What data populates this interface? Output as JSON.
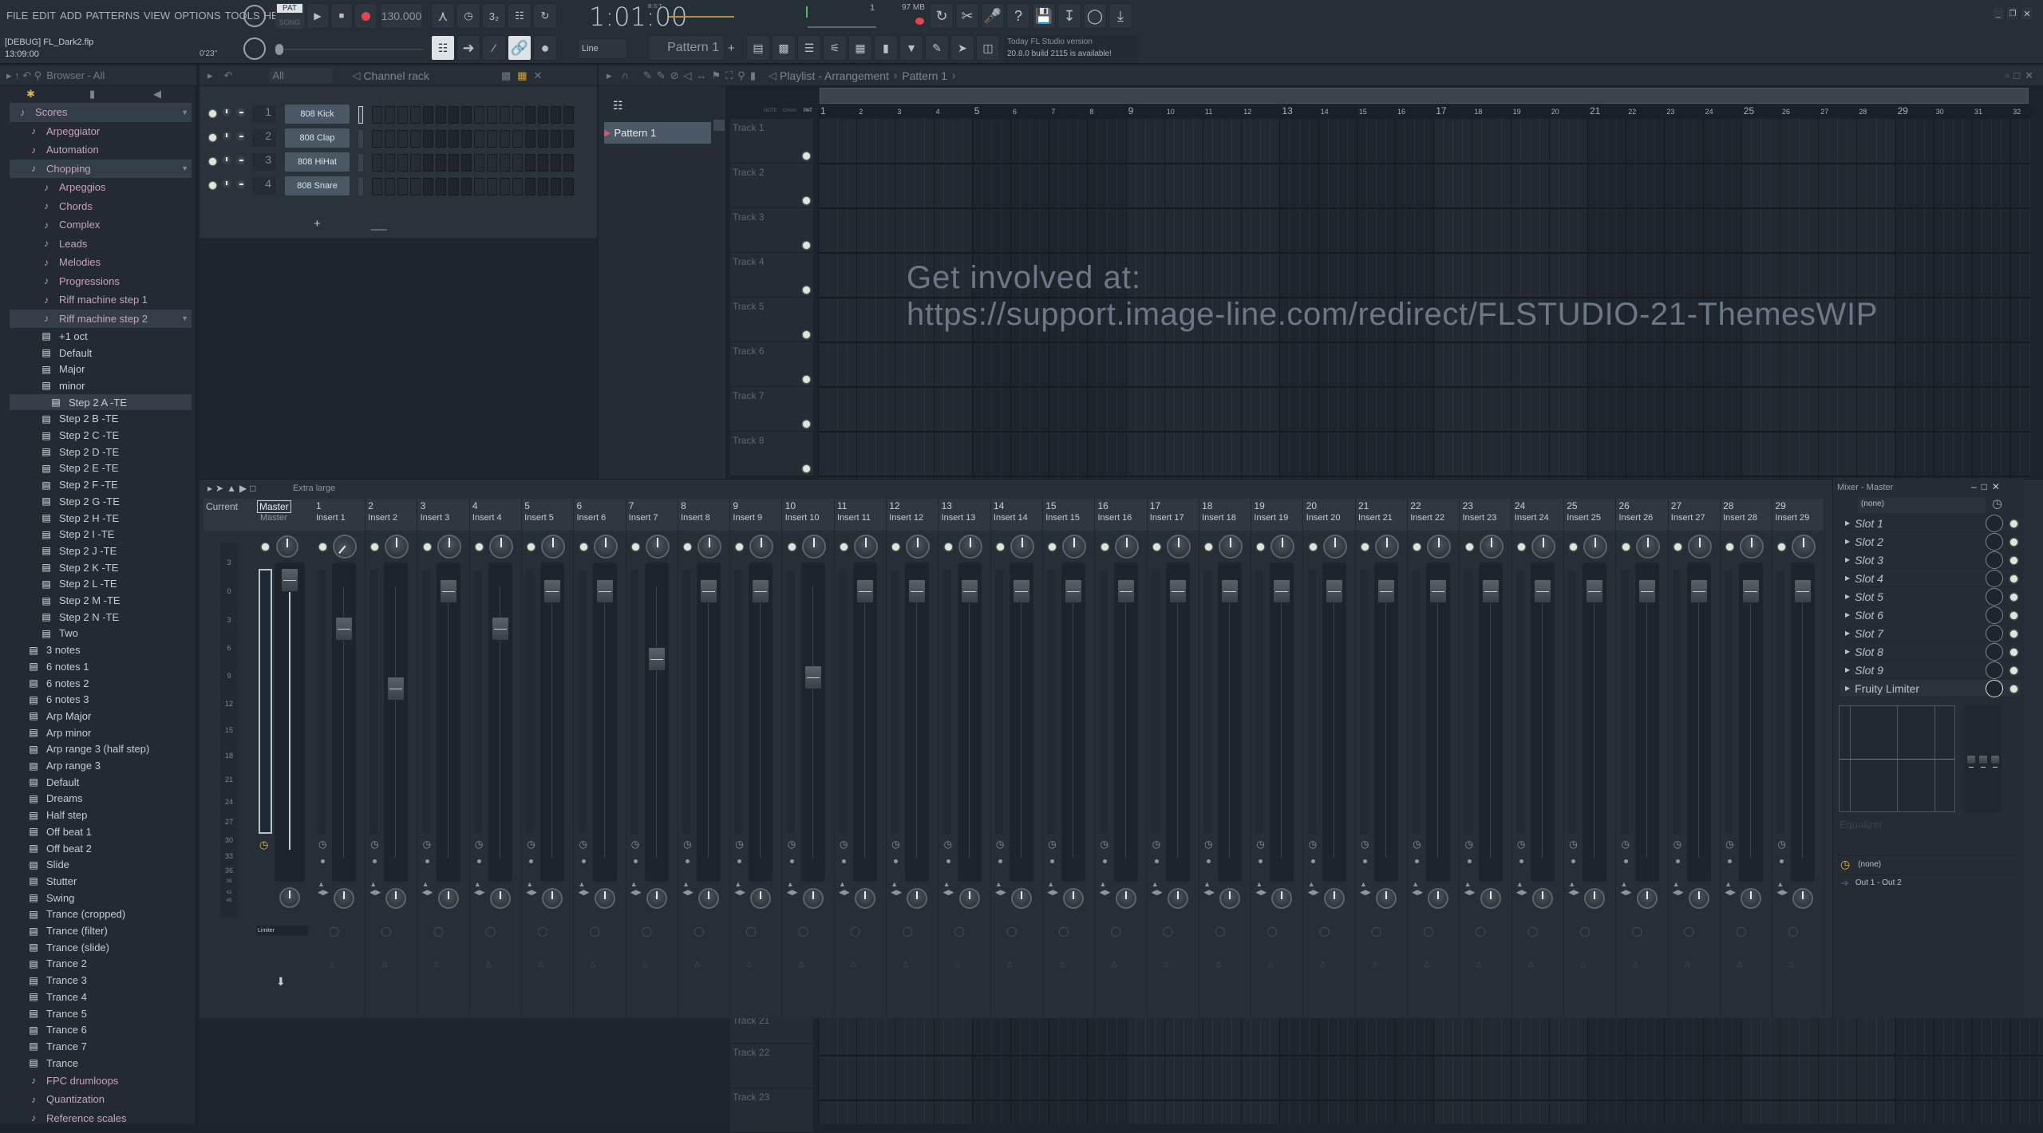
{
  "menu": [
    "FILE",
    "EDIT",
    "ADD",
    "PATTERNS",
    "VIEW",
    "OPTIONS",
    "TOOLS",
    "HELP"
  ],
  "transport": {
    "pat_label": "PAT",
    "song_label": "SONG",
    "tempo": "130.000",
    "time": "1:01:00",
    "time_format": "B:S:T",
    "record_color": "#e8434f",
    "cpu_value": "1",
    "memory": "97 MB"
  },
  "project": {
    "title": "[DEBUG] FL_Dark2.flp",
    "clock": "13:09:00",
    "length": "0'23\""
  },
  "toolbar2": {
    "snap": "Line",
    "pattern": "Pattern 1",
    "add": "+",
    "news_line1": "Today  FL Studio version",
    "news_line2": "20.8.0 build 2115 is available!"
  },
  "browser": {
    "title": "Browser - All",
    "items": [
      {
        "label": "Scores",
        "type": "folder",
        "level": 0,
        "selected": true
      },
      {
        "label": "Arpeggiator",
        "type": "folder",
        "level": 1
      },
      {
        "label": "Automation",
        "type": "folder",
        "level": 1
      },
      {
        "label": "Chopping",
        "type": "folder",
        "level": 1,
        "selected": true
      },
      {
        "label": "Arpeggios",
        "type": "folder",
        "level": 2
      },
      {
        "label": "Chords",
        "type": "folder",
        "level": 2
      },
      {
        "label": "Complex",
        "type": "folder",
        "level": 2
      },
      {
        "label": "Leads",
        "type": "folder",
        "level": 2
      },
      {
        "label": "Melodies",
        "type": "folder",
        "level": 2
      },
      {
        "label": "Progressions",
        "type": "folder",
        "level": 2
      },
      {
        "label": "Riff machine step 1",
        "type": "folder",
        "level": 2
      },
      {
        "label": "Riff machine step 2",
        "type": "folder",
        "level": 2,
        "selected": true
      },
      {
        "label": "+1 oct",
        "type": "file",
        "level": 2
      },
      {
        "label": "Default",
        "type": "file",
        "level": 2
      },
      {
        "label": "Major",
        "type": "file",
        "level": 2
      },
      {
        "label": "minor",
        "type": "file",
        "level": 2
      },
      {
        "label": "Step 2 A -TE",
        "type": "file",
        "level": 3,
        "selected": true
      },
      {
        "label": "Step 2 B -TE",
        "type": "file",
        "level": 2
      },
      {
        "label": "Step 2 C -TE",
        "type": "file",
        "level": 2
      },
      {
        "label": "Step 2 D -TE",
        "type": "file",
        "level": 2
      },
      {
        "label": "Step 2 E -TE",
        "type": "file",
        "level": 2
      },
      {
        "label": "Step 2 F -TE",
        "type": "file",
        "level": 2
      },
      {
        "label": "Step 2 G -TE",
        "type": "file",
        "level": 2
      },
      {
        "label": "Step 2 H -TE",
        "type": "file",
        "level": 2
      },
      {
        "label": "Step 2 I -TE",
        "type": "file",
        "level": 2
      },
      {
        "label": "Step 2 J -TE",
        "type": "file",
        "level": 2
      },
      {
        "label": "Step 2 K -TE",
        "type": "file",
        "level": 2
      },
      {
        "label": "Step 2 L -TE",
        "type": "file",
        "level": 2
      },
      {
        "label": "Step 2 M -TE",
        "type": "file",
        "level": 2
      },
      {
        "label": "Step 2 N -TE",
        "type": "file",
        "level": 2
      },
      {
        "label": "Two",
        "type": "file",
        "level": 2
      },
      {
        "label": "3 notes",
        "type": "file",
        "level": 1
      },
      {
        "label": "6 notes 1",
        "type": "file",
        "level": 1
      },
      {
        "label": "6 notes 2",
        "type": "file",
        "level": 1
      },
      {
        "label": "6 notes 3",
        "type": "file",
        "level": 1
      },
      {
        "label": "Arp Major",
        "type": "file",
        "level": 1
      },
      {
        "label": "Arp minor",
        "type": "file",
        "level": 1
      },
      {
        "label": "Arp range 3 (half step)",
        "type": "file",
        "level": 1
      },
      {
        "label": "Arp range 3",
        "type": "file",
        "level": 1
      },
      {
        "label": "Default",
        "type": "file",
        "level": 1
      },
      {
        "label": "Dreams",
        "type": "file",
        "level": 1
      },
      {
        "label": "Half step",
        "type": "file",
        "level": 1
      },
      {
        "label": "Off beat 1",
        "type": "file",
        "level": 1
      },
      {
        "label": "Off beat 2",
        "type": "file",
        "level": 1
      },
      {
        "label": "Slide",
        "type": "file",
        "level": 1
      },
      {
        "label": "Stutter",
        "type": "file",
        "level": 1
      },
      {
        "label": "Swing",
        "type": "file",
        "level": 1
      },
      {
        "label": "Trance (cropped)",
        "type": "file",
        "level": 1
      },
      {
        "label": "Trance (filter)",
        "type": "file",
        "level": 1
      },
      {
        "label": "Trance (slide)",
        "type": "file",
        "level": 1
      },
      {
        "label": "Trance 2",
        "type": "file",
        "level": 1
      },
      {
        "label": "Trance 3",
        "type": "file",
        "level": 1
      },
      {
        "label": "Trance 4",
        "type": "file",
        "level": 1
      },
      {
        "label": "Trance 5",
        "type": "file",
        "level": 1
      },
      {
        "label": "Trance 6",
        "type": "file",
        "level": 1
      },
      {
        "label": "Trance 7",
        "type": "file",
        "level": 1
      },
      {
        "label": "Trance",
        "type": "file",
        "level": 1
      },
      {
        "label": "FPC drumloops",
        "type": "folder",
        "level": 1
      },
      {
        "label": "Quantization",
        "type": "folder",
        "level": 1
      },
      {
        "label": "Reference scales",
        "type": "folder",
        "level": 1
      }
    ]
  },
  "channel_rack": {
    "title": "Channel rack",
    "filter": "All",
    "add": "+",
    "steps": 16,
    "channels": [
      {
        "num": "1",
        "name": "808 Kick"
      },
      {
        "num": "2",
        "name": "808 Clap"
      },
      {
        "num": "3",
        "name": "808 HiHat"
      },
      {
        "num": "4",
        "name": "808 Snare"
      }
    ]
  },
  "playlist": {
    "title": "Playlist - Arrangement",
    "pattern": "Pattern 1",
    "patterns": [
      "Pattern 1"
    ],
    "modes": [
      "NOTE",
      "CHAN",
      "PAT"
    ],
    "bars": [
      "1",
      "2",
      "3",
      "4",
      "5",
      "6",
      "7",
      "8",
      "9",
      "10",
      "11",
      "12",
      "13",
      "14",
      "15",
      "16",
      "17",
      "18",
      "19",
      "20",
      "21",
      "22",
      "23",
      "24",
      "25",
      "26",
      "27",
      "28",
      "29",
      "30",
      "31",
      "32"
    ],
    "tracks": [
      "Track 1",
      "Track 2",
      "Track 3",
      "Track 4",
      "Track 5",
      "Track 6",
      "Track 7",
      "Track 8"
    ],
    "bottom_tracks": [
      "Track 21",
      "Track 22",
      "Track 23"
    ],
    "watermark_line1": "Get involved at:",
    "watermark_line2": "https://support.image-line.com/redirect/FLSTUDIO-21-ThemesWIP"
  },
  "mixer": {
    "size": "Extra large",
    "current": "Current",
    "master_tab": "Master",
    "master_name": "Master",
    "limiter": "Limiter",
    "meter_scale": [
      "3",
      "0",
      "3",
      "6",
      "9",
      "12",
      "15",
      "18",
      "21",
      "24",
      "27",
      "30",
      "33",
      "36",
      "39",
      "42",
      "45"
    ],
    "inserts": [
      {
        "num": "1",
        "name": "Insert 1",
        "fader": 0.82,
        "pan": -100
      },
      {
        "num": "2",
        "name": "Insert 2",
        "fader": 0.6,
        "pan": 0
      },
      {
        "num": "3",
        "name": "Insert 3",
        "fader": 0.96,
        "pan": 0
      },
      {
        "num": "4",
        "name": "Insert 4",
        "fader": 0.82,
        "pan": 0
      },
      {
        "num": "5",
        "name": "Insert 5",
        "fader": 0.96,
        "pan": 0
      },
      {
        "num": "6",
        "name": "Insert 6",
        "fader": 0.96,
        "pan": 0
      },
      {
        "num": "7",
        "name": "Insert 7",
        "fader": 0.71,
        "pan": 0
      },
      {
        "num": "8",
        "name": "Insert 8",
        "fader": 0.96,
        "pan": 0
      },
      {
        "num": "9",
        "name": "Insert 9",
        "fader": 0.96,
        "pan": 0
      },
      {
        "num": "10",
        "name": "Insert 10",
        "fader": 0.64,
        "pan": 0
      },
      {
        "num": "11",
        "name": "Insert 11",
        "fader": 0.96,
        "pan": 0
      },
      {
        "num": "12",
        "name": "Insert 12",
        "fader": 0.96,
        "pan": 0
      },
      {
        "num": "13",
        "name": "Insert 13",
        "fader": 0.96,
        "pan": 0
      },
      {
        "num": "14",
        "name": "Insert 14",
        "fader": 0.96,
        "pan": 0
      },
      {
        "num": "15",
        "name": "Insert 15",
        "fader": 0.96,
        "pan": 0
      },
      {
        "num": "16",
        "name": "Insert 16",
        "fader": 0.96,
        "pan": 0
      },
      {
        "num": "17",
        "name": "Insert 17",
        "fader": 0.96,
        "pan": 0
      },
      {
        "num": "18",
        "name": "Insert 18",
        "fader": 0.96,
        "pan": 0
      },
      {
        "num": "19",
        "name": "Insert 19",
        "fader": 0.96,
        "pan": 0
      },
      {
        "num": "20",
        "name": "Insert 20",
        "fader": 0.96,
        "pan": 0
      },
      {
        "num": "21",
        "name": "Insert 21",
        "fader": 0.96,
        "pan": 0
      },
      {
        "num": "22",
        "name": "Insert 22",
        "fader": 0.96,
        "pan": 0
      },
      {
        "num": "23",
        "name": "Insert 23",
        "fader": 0.96,
        "pan": 0
      },
      {
        "num": "24",
        "name": "Insert 24",
        "fader": 0.96,
        "pan": 0
      },
      {
        "num": "25",
        "name": "Insert 25",
        "fader": 0.96,
        "pan": 0
      },
      {
        "num": "26",
        "name": "Insert 26",
        "fader": 0.96,
        "pan": 0
      },
      {
        "num": "27",
        "name": "Insert 27",
        "fader": 0.96,
        "pan": 0
      },
      {
        "num": "28",
        "name": "Insert 28",
        "fader": 0.96,
        "pan": 0
      },
      {
        "num": "29",
        "name": "Insert 29",
        "fader": 0.96,
        "pan": 0
      }
    ]
  },
  "mixer_master": {
    "title": "Mixer - Master",
    "input": "(none)",
    "slots": [
      "Slot 1",
      "Slot 2",
      "Slot 3",
      "Slot 4",
      "Slot 5",
      "Slot 6",
      "Slot 7",
      "Slot 8",
      "Slot 9",
      "Fruity Limiter"
    ],
    "eq_label": "Equalizer",
    "sidechain": "(none)",
    "output": "Out 1 - Out 2",
    "accent": "#e8b23a"
  }
}
